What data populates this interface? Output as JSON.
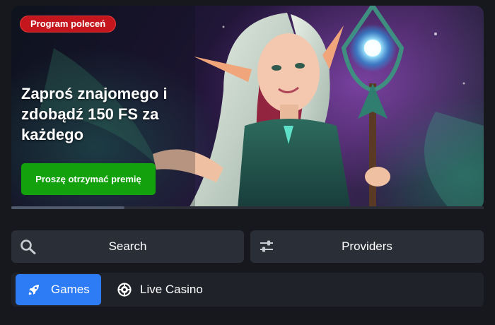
{
  "banner": {
    "badge": "Program poleceń",
    "headline": "Zaproś znajomego i zdobądź 150 FS za każdego",
    "cta_label": "Proszę otrzymać premię",
    "slider_progress": 0.24
  },
  "controls": {
    "search_label": "Search",
    "search_icon": "search-icon",
    "providers_label": "Providers",
    "providers_icon": "sliders-icon"
  },
  "tabs": [
    {
      "label": "Games",
      "icon": "rocket-icon",
      "active": true
    },
    {
      "label": "Live Casino",
      "icon": "roulette-icon",
      "active": false
    }
  ],
  "colors": {
    "badge": "#c4161c",
    "cta": "#13a10e",
    "active_tab": "#2d7cf6",
    "control_bg": "#2a2e37",
    "page_bg": "#16181d"
  }
}
